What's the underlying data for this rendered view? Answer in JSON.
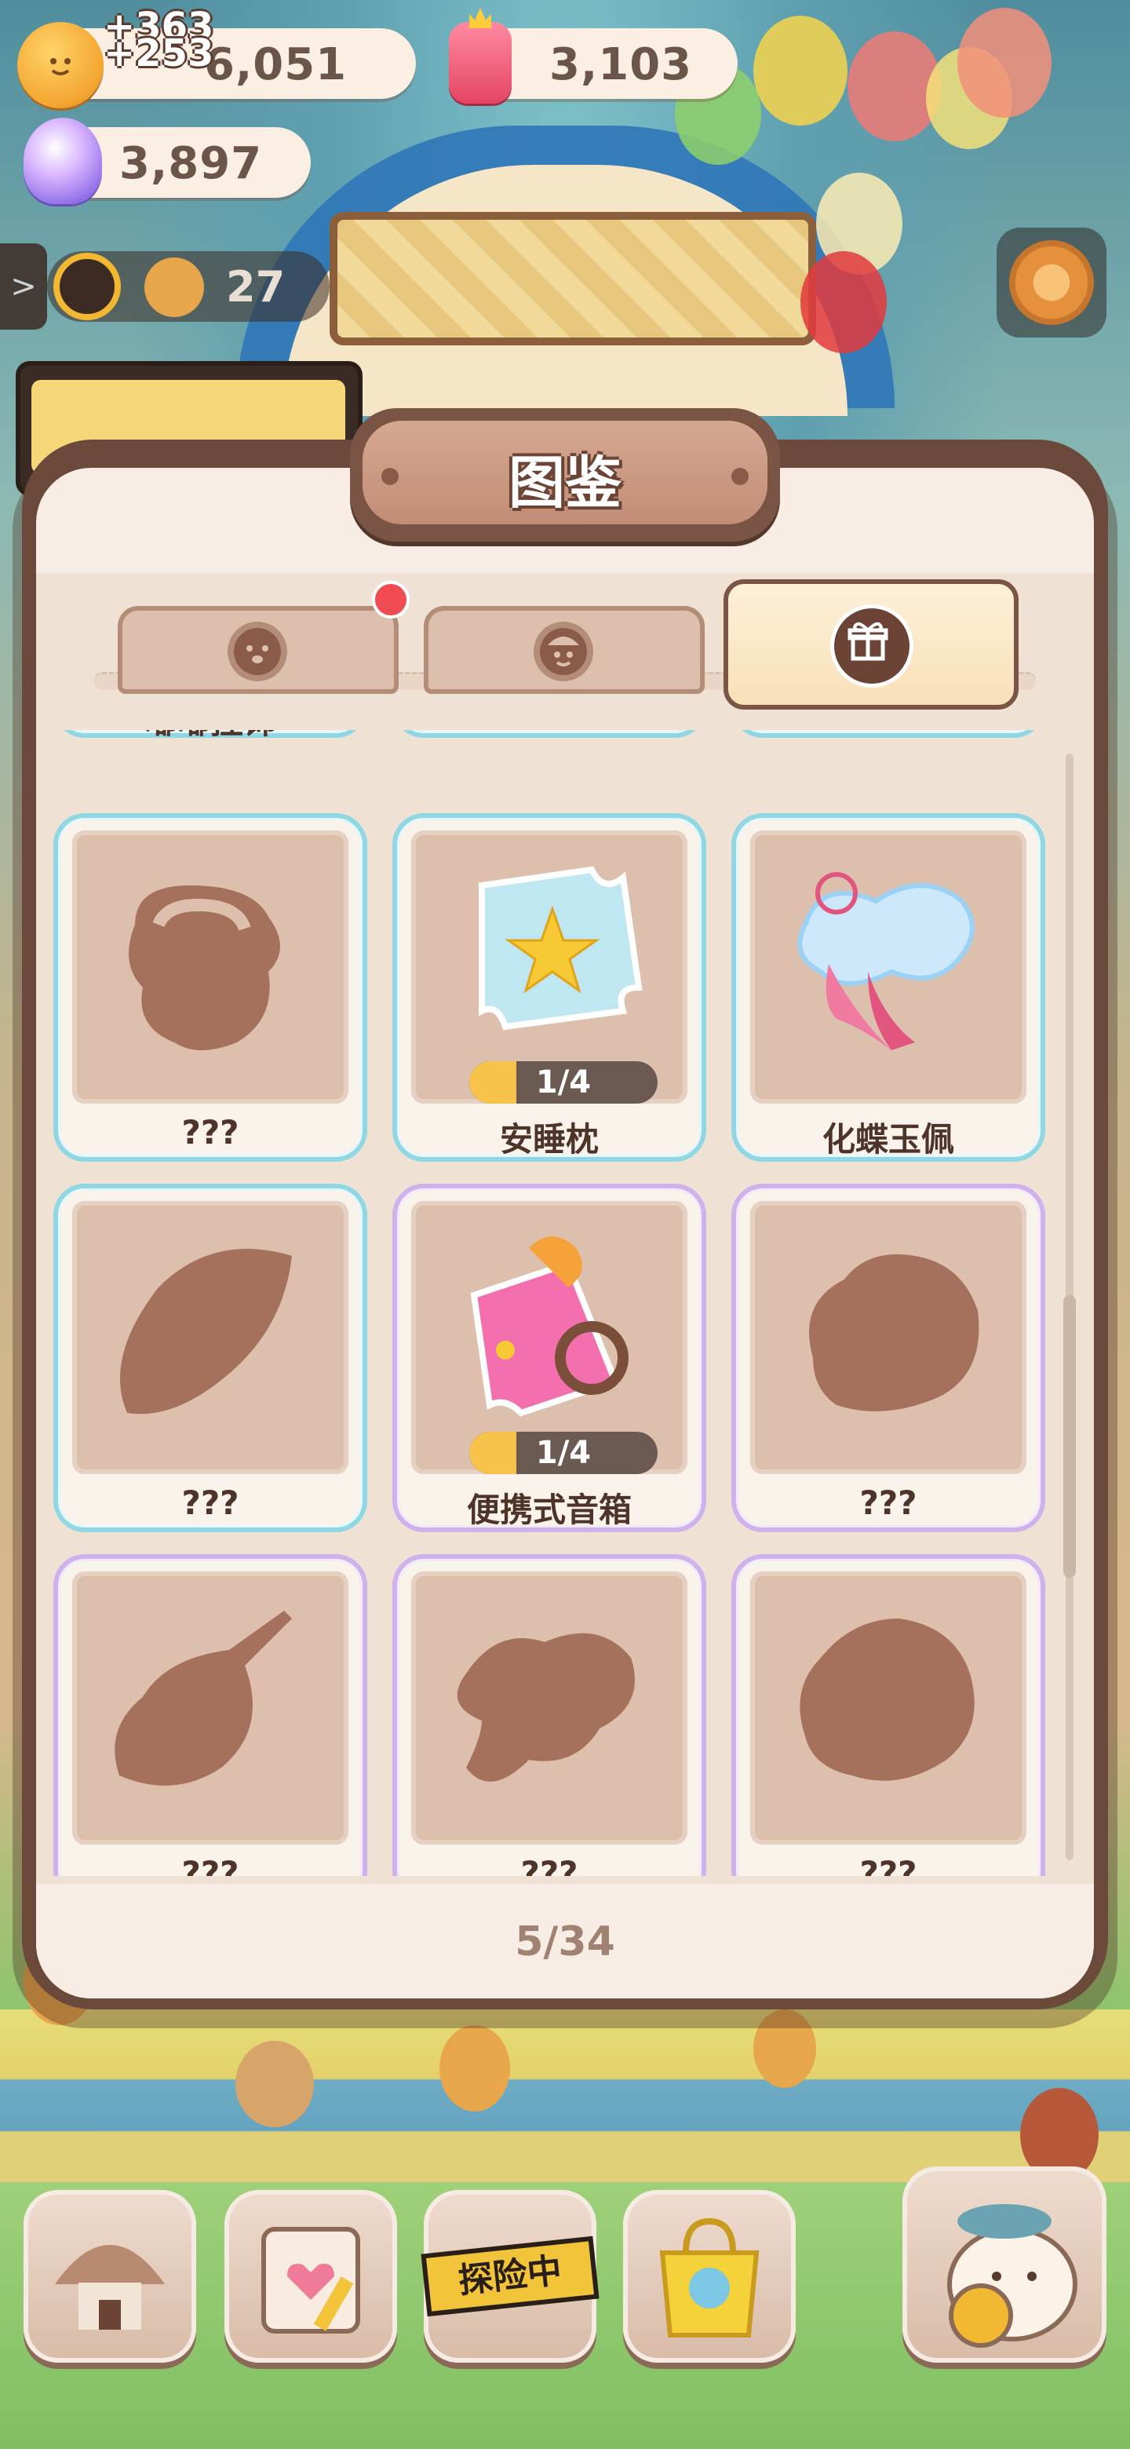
{
  "resources": {
    "coins": "6,051",
    "coin_float_1": "+363",
    "coin_float_2": "+253",
    "candy": "3,103",
    "gems": "3,897"
  },
  "hud": {
    "nav_arrow": ">",
    "cookie_count": "27"
  },
  "modal": {
    "title": "图鉴",
    "tabs": [
      {
        "name": "cookie-face-tab",
        "icon": "cookie-face-icon",
        "active": false,
        "badge": true
      },
      {
        "name": "chef-face-tab",
        "icon": "chef-face-icon",
        "active": false,
        "badge": false
      },
      {
        "name": "gift-tab",
        "icon": "gift-icon",
        "active": true,
        "badge": false
      }
    ],
    "partial_row": [
      "嘟嘟挂饰",
      "???",
      "???"
    ],
    "items": [
      {
        "label": "???",
        "progress": null
      },
      {
        "label": "安睡枕",
        "progress": "1/4",
        "fraction": 0.25
      },
      {
        "label": "化蝶玉佩",
        "progress": null
      },
      {
        "label": "???",
        "progress": null
      },
      {
        "label": "便携式音箱",
        "progress": "1/4",
        "fraction": 0.25
      },
      {
        "label": "???",
        "progress": null
      },
      {
        "label": "???",
        "progress": null
      },
      {
        "label": "???",
        "progress": null
      },
      {
        "label": "???",
        "progress": null
      }
    ],
    "page_counter": "5/34"
  },
  "bottom_nav": {
    "explore_label": "探险中"
  },
  "colors": {
    "panel_border": "#6b4a3c",
    "card_blue": "#8fd7e3",
    "card_purple": "#cfb2ec",
    "progress_fill": "#f7c34a",
    "badge_red": "#f14b52"
  }
}
